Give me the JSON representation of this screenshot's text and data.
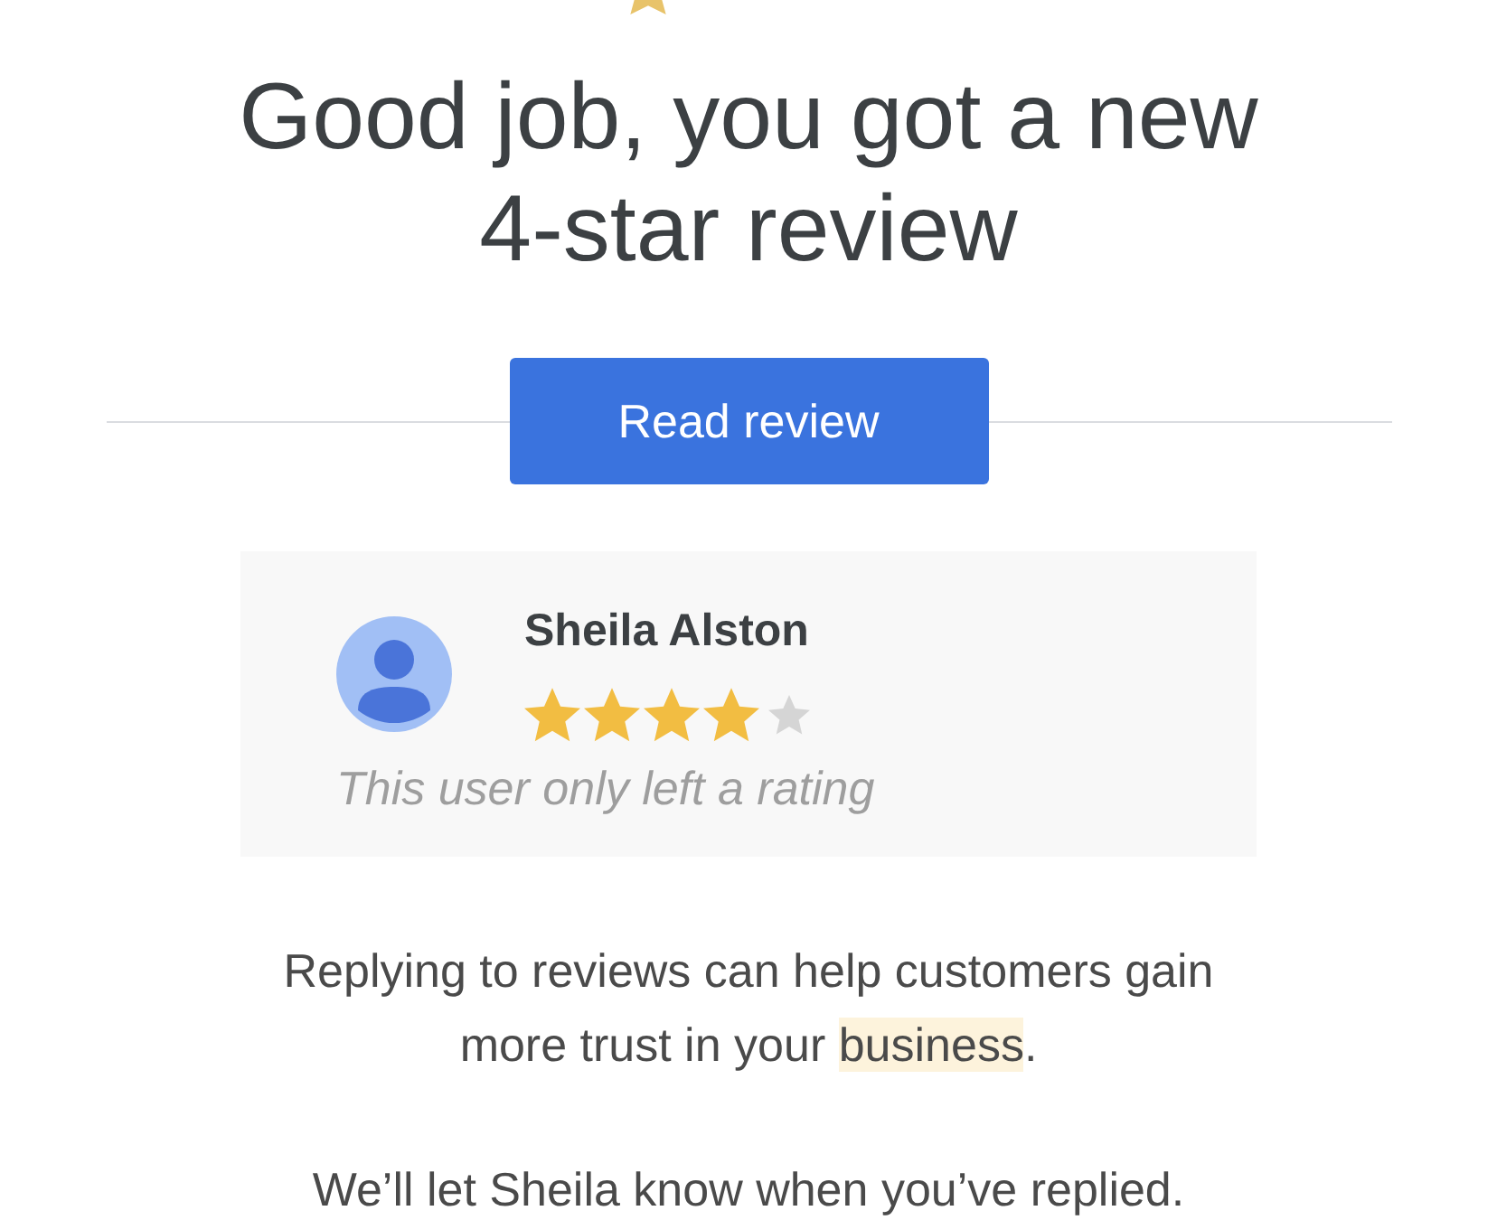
{
  "header": {
    "title": "Good job, you got a new 4-star review"
  },
  "action": {
    "button": "Read review"
  },
  "review": {
    "author": "Sheila Alston",
    "stars": 4,
    "comment": "This user only left a rating"
  },
  "message": {
    "paragraphs": [
      {
        "segments": [
          {
            "text": "Replying to reviews can help customers gain more trust in your ",
            "highlighted": false
          },
          {
            "text": "business",
            "highlighted": true
          },
          {
            "text": ".",
            "highlighted": false
          }
        ]
      },
      {
        "segments": [
          {
            "text": "We’ll let Sheila know when you’ve replied.",
            "highlighted": false
          }
        ]
      }
    ]
  }
}
